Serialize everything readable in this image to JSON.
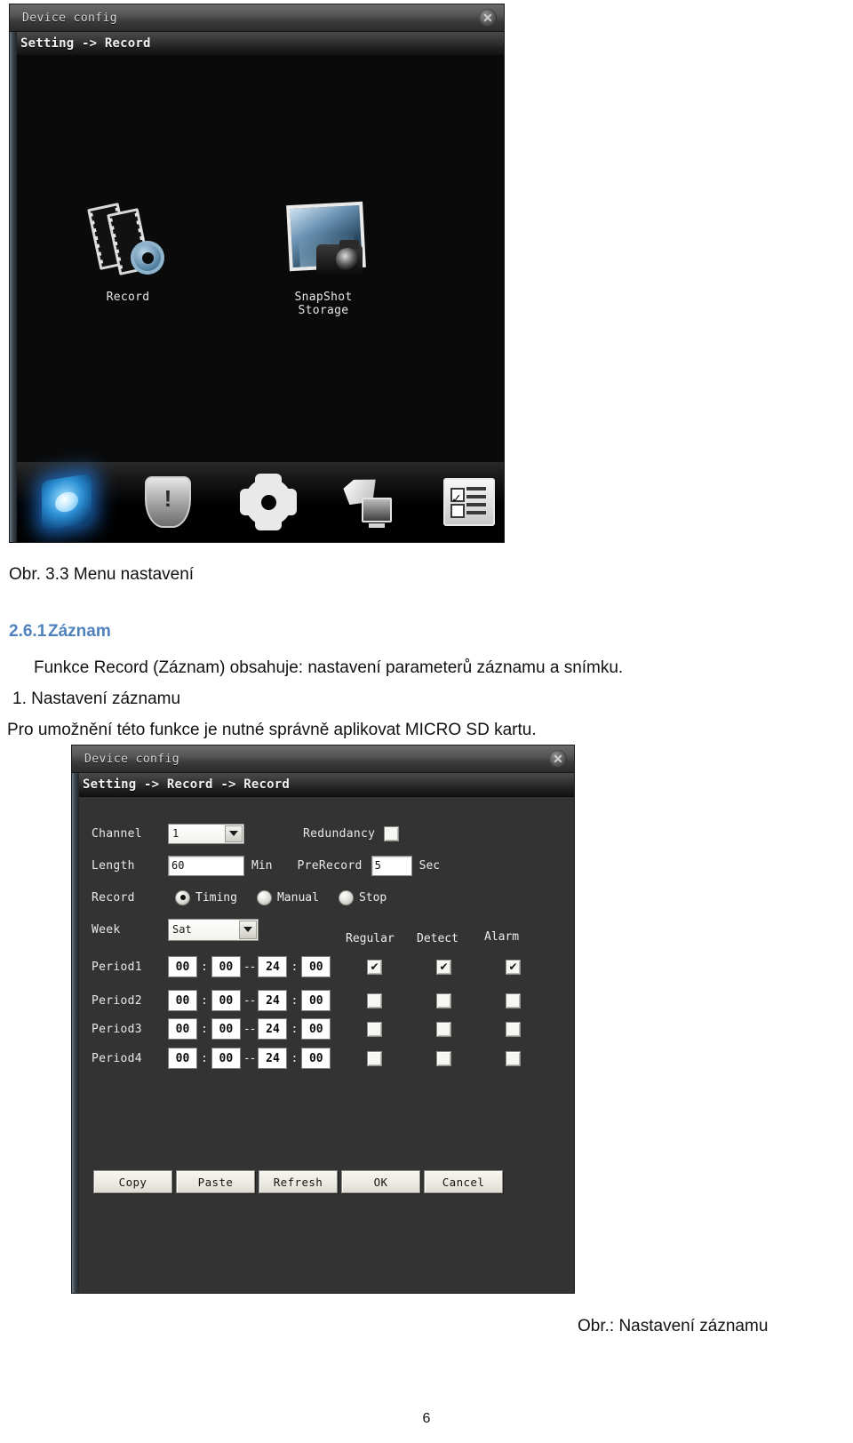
{
  "figure1": {
    "window_title": "Device config",
    "close_icon": "close-icon",
    "breadcrumb": "Setting -> Record",
    "menu_items": [
      {
        "label": "Record",
        "icon": "film-gear-icon"
      },
      {
        "label": "SnapShot Storage",
        "icon": "photo-camera-icon"
      }
    ],
    "taskbar_icons": [
      "storage-icon",
      "alarm-shield-icon",
      "system-gear-icon",
      "maintenance-icon",
      "info-checklist-icon"
    ]
  },
  "document": {
    "figure1_caption": "Obr. 3.3 Menu nastavení",
    "section_number": "2.6.1",
    "section_title": "Záznam",
    "paragraph1": "Funkce Record (Záznam) obsahuje: nastavení parameterů záznamu a snímku.",
    "list_item1": "1. Nastavení záznamu",
    "paragraph2": "Pro umožnění této funkce je nutné správně aplikovat MICRO SD kartu.",
    "figure2_caption": "Obr.: Nastavení záznamu",
    "page_number": "6"
  },
  "figure2": {
    "window_title": "Device config",
    "close_icon": "close-icon",
    "breadcrumb": "Setting -> Record -> Record",
    "fields": {
      "channel_label": "Channel",
      "channel_value": "1",
      "redundancy_label": "Redundancy",
      "redundancy_checked": false,
      "length_label": "Length",
      "length_value": "60",
      "length_unit": "Min",
      "prerecord_label": "PreRecord",
      "prerecord_value": "5",
      "prerecord_unit": "Sec",
      "record_label": "Record",
      "record_modes": [
        {
          "label": "Timing",
          "selected": true
        },
        {
          "label": "Manual",
          "selected": false
        },
        {
          "label": "Stop",
          "selected": false
        }
      ],
      "week_label": "Week",
      "week_value": "Sat"
    },
    "column_headers": [
      "Regular",
      "Detect",
      "Alarm"
    ],
    "periods": [
      {
        "label": "Period1",
        "start_hour": "00",
        "start_min": "00",
        "end_hour": "24",
        "end_min": "00",
        "regular": true,
        "detect": true,
        "alarm": true
      },
      {
        "label": "Period2",
        "start_hour": "00",
        "start_min": "00",
        "end_hour": "24",
        "end_min": "00",
        "regular": false,
        "detect": false,
        "alarm": false
      },
      {
        "label": "Period3",
        "start_hour": "00",
        "start_min": "00",
        "end_hour": "24",
        "end_min": "00",
        "regular": false,
        "detect": false,
        "alarm": false
      },
      {
        "label": "Period4",
        "start_hour": "00",
        "start_min": "00",
        "end_hour": "24",
        "end_min": "00",
        "regular": false,
        "detect": false,
        "alarm": false
      }
    ],
    "buttons": [
      "Copy",
      "Paste",
      "Refresh",
      "OK",
      "Cancel"
    ],
    "separator_colon": ":",
    "separator_dash": "--",
    "check_glyph": "✔"
  },
  "colors": {
    "heading_blue": "#4f81bd",
    "dialog_bg": "#333333",
    "menu_bg": "#0a0a0a"
  }
}
